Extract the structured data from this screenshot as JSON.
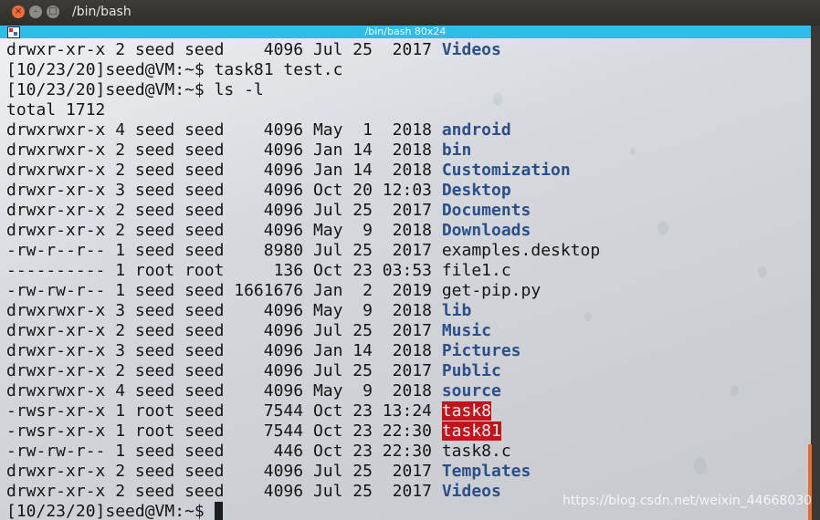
{
  "window": {
    "title": "/bin/bash",
    "tab_title": "/bin/bash 80x24",
    "buttons": {
      "close": "×",
      "minimize": "–",
      "maximize": "□"
    }
  },
  "terminal": {
    "lines": [
      {
        "type": "entry",
        "meta": "drwxr-xr-x 2 seed seed    4096 Jul 25  2017 ",
        "name": "Videos",
        "kind": "dir"
      },
      {
        "type": "prompt",
        "text": "[10/23/20]seed@VM:~$ task81 test.c"
      },
      {
        "type": "prompt",
        "text": "[10/23/20]seed@VM:~$ ls -l"
      },
      {
        "type": "text",
        "text": "total 1712"
      },
      {
        "type": "entry",
        "meta": "drwxrwxr-x 4 seed seed    4096 May  1  2018 ",
        "name": "android",
        "kind": "dir"
      },
      {
        "type": "entry",
        "meta": "drwxrwxr-x 2 seed seed    4096 Jan 14  2018 ",
        "name": "bin",
        "kind": "dir"
      },
      {
        "type": "entry",
        "meta": "drwxrwxr-x 2 seed seed    4096 Jan 14  2018 ",
        "name": "Customization",
        "kind": "dir"
      },
      {
        "type": "entry",
        "meta": "drwxr-xr-x 3 seed seed    4096 Oct 20 12:03 ",
        "name": "Desktop",
        "kind": "dir"
      },
      {
        "type": "entry",
        "meta": "drwxr-xr-x 2 seed seed    4096 Jul 25  2017 ",
        "name": "Documents",
        "kind": "dir"
      },
      {
        "type": "entry",
        "meta": "drwxr-xr-x 2 seed seed    4096 May  9  2018 ",
        "name": "Downloads",
        "kind": "dir"
      },
      {
        "type": "entry",
        "meta": "-rw-r--r-- 1 seed seed    8980 Jul 25  2017 ",
        "name": "examples.desktop",
        "kind": "file"
      },
      {
        "type": "entry",
        "meta": "---------- 1 root root     136 Oct 23 03:53 ",
        "name": "file1.c",
        "kind": "file"
      },
      {
        "type": "entry",
        "meta": "-rw-rw-r-- 1 seed seed 1661676 Jan  2  2019 ",
        "name": "get-pip.py",
        "kind": "file"
      },
      {
        "type": "entry",
        "meta": "drwxrwxr-x 3 seed seed    4096 May  9  2018 ",
        "name": "lib",
        "kind": "dir"
      },
      {
        "type": "entry",
        "meta": "drwxr-xr-x 2 seed seed    4096 Jul 25  2017 ",
        "name": "Music",
        "kind": "dir"
      },
      {
        "type": "entry",
        "meta": "drwxr-xr-x 3 seed seed    4096 Jan 14  2018 ",
        "name": "Pictures",
        "kind": "dir"
      },
      {
        "type": "entry",
        "meta": "drwxr-xr-x 2 seed seed    4096 Jul 25  2017 ",
        "name": "Public",
        "kind": "dir"
      },
      {
        "type": "entry",
        "meta": "drwxrwxr-x 4 seed seed    4096 May  9  2018 ",
        "name": "source",
        "kind": "dir"
      },
      {
        "type": "entry",
        "meta": "-rwsr-xr-x 1 root seed    7544 Oct 23 13:24 ",
        "name": "task8",
        "kind": "setuid"
      },
      {
        "type": "entry",
        "meta": "-rwsr-xr-x 1 root seed    7544 Oct 23 22:30 ",
        "name": "task81",
        "kind": "setuid"
      },
      {
        "type": "entry",
        "meta": "-rw-rw-r-- 1 seed seed     446 Oct 23 22:30 ",
        "name": "task8.c",
        "kind": "file"
      },
      {
        "type": "entry",
        "meta": "drwxr-xr-x 2 seed seed    4096 Jul 25  2017 ",
        "name": "Templates",
        "kind": "dir"
      },
      {
        "type": "entry",
        "meta": "drwxr-xr-x 2 seed seed    4096 Jul 25  2017 ",
        "name": "Videos",
        "kind": "dir"
      },
      {
        "type": "prompt",
        "text": "[10/23/20]seed@VM:~$ ",
        "cursor": true
      }
    ]
  },
  "watermark": "https://blog.csdn.net/weixin_44668030",
  "colors": {
    "dir": "#2c4f8a",
    "setuid_bg": "#c4141b",
    "tab": "#2dbde8",
    "scroll_thumb": "#ef6a2e"
  }
}
